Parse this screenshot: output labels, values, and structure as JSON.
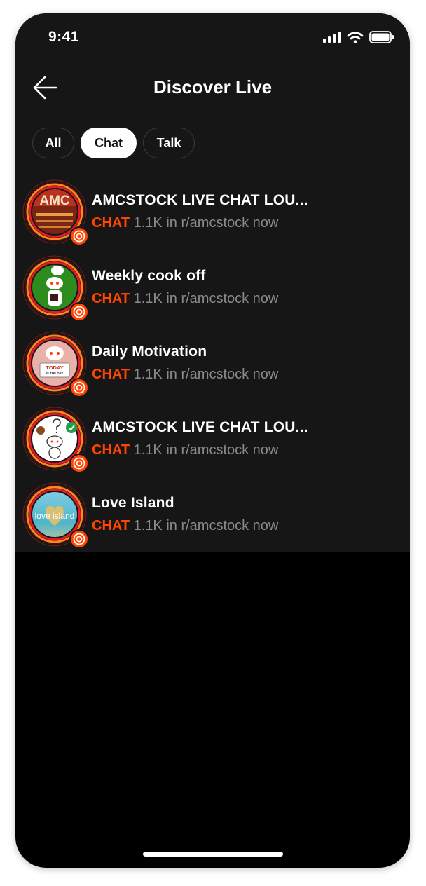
{
  "status_bar": {
    "time": "9:41"
  },
  "header": {
    "title": "Discover Live"
  },
  "filters": [
    {
      "label": "All",
      "active": false
    },
    {
      "label": "Chat",
      "active": true
    },
    {
      "label": "Talk",
      "active": false
    }
  ],
  "rooms": [
    {
      "name": "AMCSTOCK LIVE CHAT LOU...",
      "tag": "CHAT",
      "meta": "1.1K in r/amcstock now",
      "avatar": "amc-theater",
      "avatar_text": "AMC"
    },
    {
      "name": "Weekly cook off",
      "tag": "CHAT",
      "meta": "1.1K in r/amcstock now",
      "avatar": "chef-snoo"
    },
    {
      "name": "Daily Motivation",
      "tag": "CHAT",
      "meta": "1.1K in r/amcstock now",
      "avatar": "sign-snoo",
      "avatar_text": "TODAY",
      "avatar_subtext": "IS THE DAY"
    },
    {
      "name": "AMCSTOCK LIVE CHAT LOU...",
      "tag": "CHAT",
      "meta": "1.1K in r/amcstock now",
      "avatar": "question-snoo"
    },
    {
      "name": "Love Island",
      "tag": "CHAT",
      "meta": "1.1K in r/amcstock now",
      "avatar": "love-island",
      "avatar_text": "love island"
    }
  ],
  "colors": {
    "accent": "#ff4500",
    "ring_orange": "#ff8717",
    "ring_red": "#e4192b",
    "background": "#161616"
  }
}
